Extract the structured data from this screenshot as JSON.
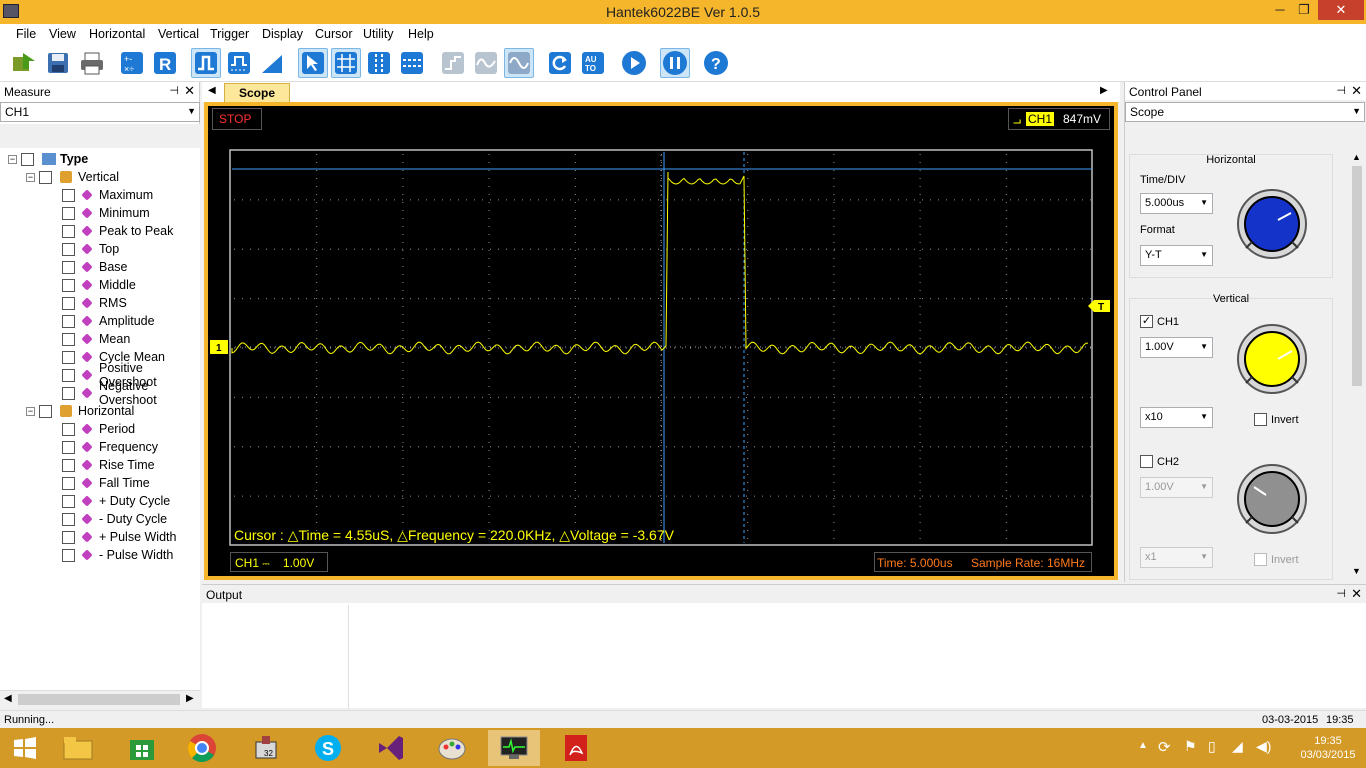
{
  "window": {
    "title": "Hantek6022BE Ver 1.0.5",
    "minimize": "─",
    "maximize": "❐",
    "close": "✕"
  },
  "menu": [
    "File",
    "View",
    "Horizontal",
    "Vertical",
    "Trigger",
    "Display",
    "Cursor",
    "Utility",
    "Help"
  ],
  "toolbar_icons": [
    "open-icon",
    "save-icon",
    "print-icon",
    "math-icon",
    "reference-icon",
    "rising-edge-icon",
    "pulse-trigger-icon",
    "slope-icon",
    "cursor-select-icon",
    "grid-icon",
    "vertical-cursor-icon",
    "horizontal-cursor-icon",
    "step-icon",
    "sine-dim-icon",
    "sine-icon",
    "refresh-icon",
    "auto-icon",
    "run-icon",
    "pause-icon",
    "help-icon"
  ],
  "measure": {
    "title": "Measure",
    "channel": "CH1",
    "root": "Type",
    "vertical_group": "Vertical",
    "vertical_items": [
      "Maximum",
      "Minimum",
      "Peak to Peak",
      "Top",
      "Base",
      "Middle",
      "RMS",
      "Amplitude",
      "Mean",
      "Cycle Mean",
      "Positive Overshoot",
      "Negative Overshoot"
    ],
    "horizontal_group": "Horizontal",
    "horizontal_items": [
      "Period",
      "Frequency",
      "Rise Time",
      "Fall Time",
      "+ Duty Cycle",
      "- Duty Cycle",
      "+ Pulse Width",
      "- Pulse Width"
    ]
  },
  "scope": {
    "tab": "Scope",
    "status": "STOP",
    "trigger_channel": "CH1",
    "trigger_level": "847mV",
    "ch_marker": "1",
    "trig_marker": "T",
    "cursor_readout": "Cursor : △Time = 4.55uS, △Frequency = 220.0KHz, △Voltage = -3.67V",
    "ch_label": "CH1",
    "ch_coupling": "⎓",
    "ch_scale": "1.00V",
    "time_label": "Time: 5.000us",
    "sample_rate": "Sample Rate: 16MHz"
  },
  "control": {
    "title": "Control Panel",
    "mode": "Scope",
    "horizontal_title": "Horizontal",
    "timediv_label": "Time/DIV",
    "timediv": "5.000us",
    "format_label": "Format",
    "format": "Y-T",
    "vertical_title": "Vertical",
    "ch1_label": "CH1",
    "ch1_volt": "1.00V",
    "ch1_probe": "x10",
    "ch1_invert": "Invert",
    "ch2_label": "CH2",
    "ch2_volt": "1.00V",
    "ch2_probe": "x1",
    "ch2_invert": "Invert"
  },
  "output": {
    "title": "Output"
  },
  "status": {
    "left": "Running...",
    "date": "03-03-2015",
    "time": "19:35"
  },
  "taskbar": {
    "clock_time": "19:35",
    "clock_date": "03/03/2015"
  },
  "colors": {
    "accent": "#f5b62c",
    "trace": "#ffff00",
    "cursor": "#3fa0ff",
    "screen": "#000000"
  }
}
